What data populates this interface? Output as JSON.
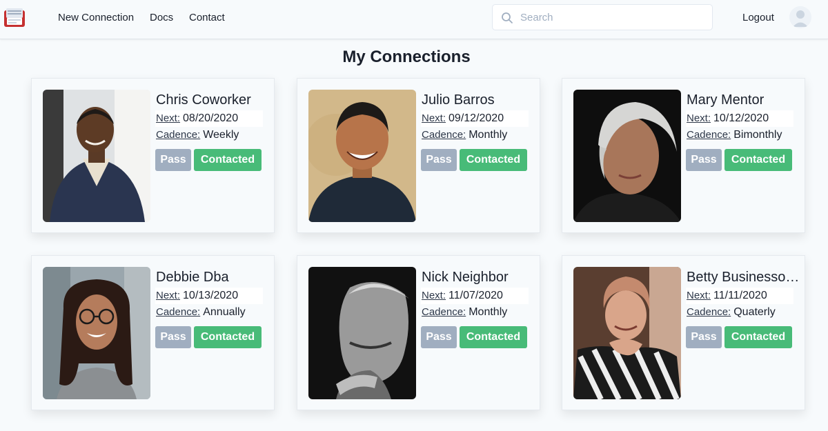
{
  "nav": {
    "links": [
      "New Connection",
      "Docs",
      "Contact"
    ],
    "logout_label": "Logout"
  },
  "search": {
    "placeholder": "Search",
    "value": ""
  },
  "page": {
    "title": "My Connections"
  },
  "buttons": {
    "pass_label": "Pass",
    "contacted_label": "Contacted"
  },
  "labels": {
    "next": "Next:",
    "cadence": "Cadence:"
  },
  "colors": {
    "pass": "#a0aec0",
    "contacted": "#48bb78",
    "background": "#f7fafc"
  },
  "connections": [
    {
      "name": "Chris Coworker",
      "next": "08/20/2020",
      "cadence": "Weekly"
    },
    {
      "name": "Julio Barros",
      "next": "09/12/2020",
      "cadence": "Monthly"
    },
    {
      "name": "Mary Mentor",
      "next": "10/12/2020",
      "cadence": "Bimonthly"
    },
    {
      "name": "Debbie Dba",
      "next": "10/13/2020",
      "cadence": "Annually"
    },
    {
      "name": "Nick Neighbor",
      "next": "11/07/2020",
      "cadence": "Monthly"
    },
    {
      "name": "Betty Businessowner",
      "next": "11/11/2020",
      "cadence": "Quaterly"
    }
  ]
}
